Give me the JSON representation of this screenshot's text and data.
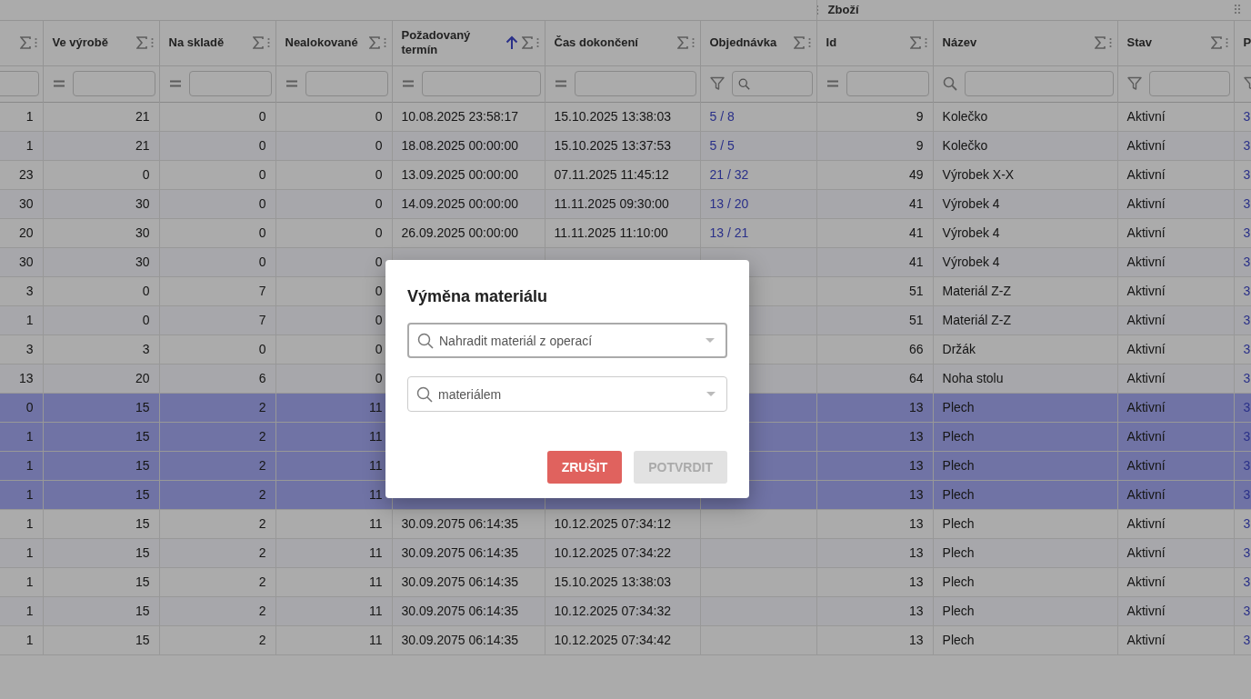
{
  "group_header": {
    "label": "Zboží"
  },
  "columns": [
    {
      "kind": "number",
      "sorted": false,
      "filter": {
        "kind": "plain"
      }
    },
    {
      "label": "Ve výrobě",
      "kind": "number",
      "sorted": false,
      "filter": {
        "kind": "equals"
      }
    },
    {
      "label": "Na skladě",
      "kind": "number",
      "sorted": false,
      "filter": {
        "kind": "equals"
      }
    },
    {
      "label": "Nealokované",
      "kind": "number",
      "sorted": false,
      "filter": {
        "kind": "equals"
      }
    },
    {
      "label": "Požadovaný termín",
      "kind": "text",
      "sorted": true,
      "filter": {
        "kind": "equals"
      }
    },
    {
      "label": "Čas dokončení",
      "kind": "text",
      "sorted": false,
      "filter": {
        "kind": "equals"
      }
    },
    {
      "label": "Objednávka",
      "kind": "link",
      "sorted": false,
      "filter": {
        "kind": "funnel_search"
      }
    },
    {
      "label": "Id",
      "kind": "number",
      "sorted": false,
      "filter": {
        "kind": "equals"
      }
    },
    {
      "label": "Název",
      "kind": "text",
      "sorted": false,
      "filter": {
        "kind": "search"
      }
    },
    {
      "label": "Stav",
      "kind": "text",
      "sorted": false,
      "filter": {
        "kind": "funnel"
      }
    },
    {
      "label": "P",
      "kind": "link",
      "sorted": false,
      "filter": {
        "kind": "funnel_icon"
      }
    }
  ],
  "rows": [
    {
      "selected": false,
      "cells": [
        "1",
        "21",
        "0",
        "0",
        "10.08.2025 23:58:17",
        "15.10.2025 13:38:03",
        "5 / 8",
        "9",
        "Kolečko",
        "Aktivní",
        "3"
      ]
    },
    {
      "selected": false,
      "cells": [
        "1",
        "21",
        "0",
        "0",
        "18.08.2025 00:00:00",
        "15.10.2025 13:37:53",
        "5 / 5",
        "9",
        "Kolečko",
        "Aktivní",
        "3"
      ]
    },
    {
      "selected": false,
      "cells": [
        "23",
        "0",
        "0",
        "0",
        "13.09.2025 00:00:00",
        "07.11.2025 11:45:12",
        "21 / 32",
        "49",
        "Výrobek X-X",
        "Aktivní",
        "3"
      ]
    },
    {
      "selected": false,
      "cells": [
        "30",
        "30",
        "0",
        "0",
        "14.09.2025 00:00:00",
        "11.11.2025 09:30:00",
        "13 / 20",
        "41",
        "Výrobek 4",
        "Aktivní",
        "3"
      ]
    },
    {
      "selected": false,
      "cells": [
        "20",
        "30",
        "0",
        "0",
        "26.09.2025 00:00:00",
        "11.11.2025 11:10:00",
        "13 / 21",
        "41",
        "Výrobek 4",
        "Aktivní",
        "3"
      ]
    },
    {
      "selected": false,
      "cells": [
        "30",
        "30",
        "0",
        "0",
        null,
        null,
        null,
        "41",
        "Výrobek 4",
        "Aktivní",
        "3"
      ]
    },
    {
      "selected": false,
      "cells": [
        "3",
        "0",
        "7",
        "0",
        null,
        null,
        null,
        "51",
        "Materiál Z-Z",
        "Aktivní",
        "3"
      ]
    },
    {
      "selected": false,
      "cells": [
        "1",
        "0",
        "7",
        "0",
        null,
        null,
        null,
        "51",
        "Materiál Z-Z",
        "Aktivní",
        "3"
      ]
    },
    {
      "selected": false,
      "cells": [
        "3",
        "3",
        "0",
        "0",
        null,
        null,
        null,
        "66",
        "Držák",
        "Aktivní",
        "3"
      ]
    },
    {
      "selected": false,
      "cells": [
        "13",
        "20",
        "6",
        "0",
        null,
        null,
        null,
        "64",
        "Noha stolu",
        "Aktivní",
        "3"
      ]
    },
    {
      "selected": true,
      "cells": [
        "0",
        "15",
        "2",
        "11",
        null,
        null,
        null,
        "13",
        "Plech",
        "Aktivní",
        "3"
      ]
    },
    {
      "selected": true,
      "cells": [
        "1",
        "15",
        "2",
        "11",
        null,
        null,
        null,
        "13",
        "Plech",
        "Aktivní",
        "3"
      ]
    },
    {
      "selected": true,
      "cells": [
        "1",
        "15",
        "2",
        "11",
        null,
        null,
        null,
        "13",
        "Plech",
        "Aktivní",
        "3"
      ]
    },
    {
      "selected": true,
      "cells": [
        "1",
        "15",
        "2",
        "11",
        null,
        null,
        null,
        "13",
        "Plech",
        "Aktivní",
        "3"
      ]
    },
    {
      "selected": false,
      "cells": [
        "1",
        "15",
        "2",
        "11",
        "30.09.2075 06:14:35",
        "10.12.2025 07:34:12",
        null,
        "13",
        "Plech",
        "Aktivní",
        "3"
      ]
    },
    {
      "selected": false,
      "cells": [
        "1",
        "15",
        "2",
        "11",
        "30.09.2075 06:14:35",
        "10.12.2025 07:34:22",
        null,
        "13",
        "Plech",
        "Aktivní",
        "3"
      ]
    },
    {
      "selected": false,
      "cells": [
        "1",
        "15",
        "2",
        "11",
        "30.09.2075 06:14:35",
        "15.10.2025 13:38:03",
        null,
        "13",
        "Plech",
        "Aktivní",
        "3"
      ]
    },
    {
      "selected": false,
      "cells": [
        "1",
        "15",
        "2",
        "11",
        "30.09.2075 06:14:35",
        "10.12.2025 07:34:32",
        null,
        "13",
        "Plech",
        "Aktivní",
        "3"
      ]
    },
    {
      "selected": false,
      "cells": [
        "1",
        "15",
        "2",
        "11",
        "30.09.2075 06:14:35",
        "10.12.2025 07:34:42",
        null,
        "13",
        "Plech",
        "Aktivní",
        "3"
      ]
    }
  ],
  "dialog": {
    "title": "Výměna materiálu",
    "fields": [
      {
        "placeholder": "Nahradit materiál z operací",
        "focused": true
      },
      {
        "placeholder": "materiálem",
        "focused": false
      }
    ],
    "buttons": [
      {
        "label": "ZRUŠIT",
        "kind": "cancel",
        "disabled": false
      },
      {
        "label": "POTVRDIT",
        "kind": "confirm",
        "disabled": true
      }
    ]
  }
}
